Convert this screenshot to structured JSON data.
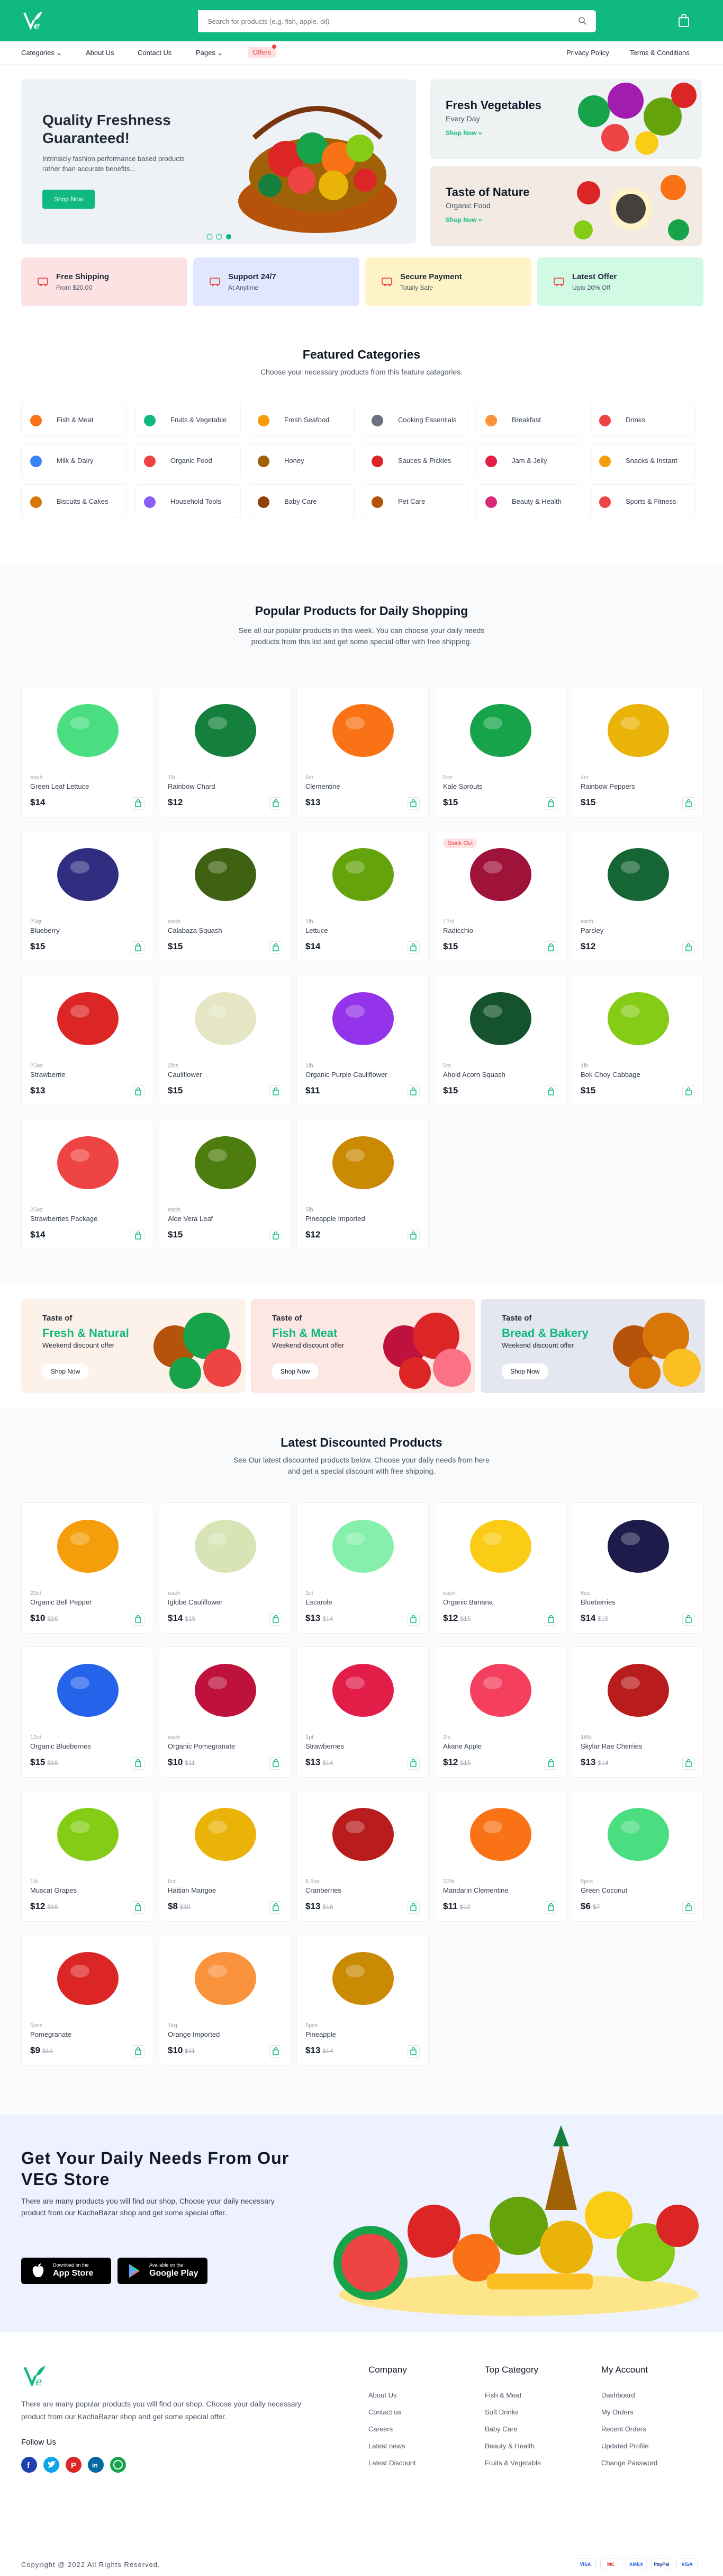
{
  "header": {
    "search_placeholder": "Search for products (e.g. fish, apple, oil)"
  },
  "nav": {
    "categories": "Categories",
    "about": "About Us",
    "contact": "Contact Us",
    "pages": "Pages",
    "offers": "Offers",
    "privacy": "Privacy Policy",
    "terms": "Terms & Conditions"
  },
  "hero": {
    "title": "Quality Freshness Guaranteed!",
    "text": "Intrinsicly fashion performance based products rather than accurate benefits...",
    "button": "Shop Now",
    "slides": 3,
    "active_slide": 3
  },
  "side_banners": [
    {
      "title": "Fresh Vegetables",
      "subtitle": "Every Day",
      "link": "Shop Now »"
    },
    {
      "title": "Taste of Nature",
      "subtitle": "Organic Food",
      "link": "Shop Now »"
    }
  ],
  "features": [
    {
      "title": "Free Shipping",
      "sub": "From $20.00",
      "icon": "truck-icon",
      "bg": "#fde2e4"
    },
    {
      "title": "Support 24/7",
      "sub": "At Anytime",
      "icon": "phone-icon",
      "bg": "#e0e7ff"
    },
    {
      "title": "Secure Payment",
      "sub": "Totally Safe",
      "icon": "card-icon",
      "bg": "#fef3c7"
    },
    {
      "title": "Latest Offer",
      "sub": "Upto 20% Off",
      "icon": "gift-icon",
      "bg": "#d1fae5"
    }
  ],
  "featured": {
    "title": "Featured Categories",
    "sub": "Choose your necessary products from this feature categories."
  },
  "categories": [
    "Fish & Meat",
    "Fruits & Vegetable",
    "Fresh Seafood",
    "Cooking Essentials",
    "Breakfast",
    "Drinks",
    "Milk & Dairy",
    "Organic Food",
    "Honey",
    "Sauces & Pickles",
    "Jam & Jelly",
    "Snacks & Instant",
    "Biscuits & Cakes",
    "Household Tools",
    "Baby Care",
    "Pet Care",
    "Beauty & Health",
    "Sports & Fitness"
  ],
  "category_colors": [
    "#f97316",
    "#10b981",
    "#f59e0b",
    "#6b7280",
    "#fb923c",
    "#ef4444",
    "#3b82f6",
    "#ef4444",
    "#a16207",
    "#dc2626",
    "#e11d48",
    "#f59e0b",
    "#d97706",
    "#8b5cf6",
    "#92400e",
    "#b45309",
    "#db2777",
    "#ef4444"
  ],
  "popular": {
    "title": "Popular Products for Daily Shopping",
    "sub": "See all our popular products in this week. You can choose your daily needs products from this list and get some special offer with free shipping."
  },
  "popular_products": [
    {
      "unit": "each",
      "name": "Green Leaf Lettuce",
      "price": "$14",
      "color": "#4ade80"
    },
    {
      "unit": "1lb",
      "name": "Rainbow Chard",
      "price": "$12",
      "color": "#15803d"
    },
    {
      "unit": "6ct",
      "name": "Clementine",
      "price": "$13",
      "color": "#f97316"
    },
    {
      "unit": "5oz",
      "name": "Kale Sprouts",
      "price": "$15",
      "color": "#16a34a"
    },
    {
      "unit": "4ct",
      "name": "Rainbow Peppers",
      "price": "$15",
      "color": "#eab308"
    },
    {
      "unit": "25qt",
      "name": "Blueberry",
      "price": "$15",
      "color": "#312e81"
    },
    {
      "unit": "each",
      "name": "Calabaza Squash",
      "price": "$15",
      "color": "#3f6212"
    },
    {
      "unit": "1lb",
      "name": "Lettuce",
      "price": "$14",
      "color": "#65a30d"
    },
    {
      "unit": "12ct",
      "name": "Radicchio",
      "price": "$15",
      "color": "#9f1239",
      "badge": "Stock Out"
    },
    {
      "unit": "each",
      "name": "Parsley",
      "price": "$12",
      "color": "#166534"
    },
    {
      "unit": "25oz",
      "name": "Strawberrie",
      "price": "$13",
      "color": "#dc2626"
    },
    {
      "unit": "2lbs",
      "name": "Cauliflower",
      "price": "$15",
      "color": "#e5e7c4"
    },
    {
      "unit": "1lb",
      "name": "Organic Purple Cauliflower",
      "price": "$11",
      "color": "#9333ea"
    },
    {
      "unit": "5ct",
      "name": "Ahold Acorn Squash",
      "price": "$15",
      "color": "#14532d"
    },
    {
      "unit": "1lb",
      "name": "Bok Choy Cabbage",
      "price": "$15",
      "color": "#84cc16"
    },
    {
      "unit": "25oz",
      "name": "Strawberries Package",
      "price": "$14",
      "color": "#ef4444"
    },
    {
      "unit": "each",
      "name": "Aloe Vera Leaf",
      "price": "$15",
      "color": "#4d7c0f"
    },
    {
      "unit": "5lb",
      "name": "Pineapple Imported",
      "price": "$12",
      "color": "#ca8a04"
    }
  ],
  "promos": [
    {
      "taste": "Taste of",
      "head": "Fresh & Natural",
      "sub": "Weekend discount offer",
      "btn": "Shop Now",
      "bg": "#fdf2e9"
    },
    {
      "taste": "Taste of",
      "head": "Fish & Meat",
      "sub": "Weekend discount offer",
      "btn": "Shop Now",
      "bg": "#fce7e2"
    },
    {
      "taste": "Taste of",
      "head": "Bread & Bakery",
      "sub": "Weekend discount offer",
      "btn": "Shop Now",
      "bg": "#e5e7f0"
    }
  ],
  "discount": {
    "title": "Latest Discounted Products",
    "sub": "See Our latest discounted products below. Choose your daily needs from here and get a special discount with free shipping."
  },
  "discount_products": [
    {
      "unit": "22ct",
      "name": "Organic Bell Pepper",
      "price": "$10",
      "old": "$16",
      "color": "#f59e0b"
    },
    {
      "unit": "each",
      "name": "Iglobe Cauliflower",
      "price": "$14",
      "old": "$15",
      "color": "#d9e4b6"
    },
    {
      "unit": "1ct",
      "name": "Escarole",
      "price": "$13",
      "old": "$14",
      "color": "#86efac"
    },
    {
      "unit": "each",
      "name": "Organic Banana",
      "price": "$12",
      "old": "$15",
      "color": "#facc15"
    },
    {
      "unit": "6oz",
      "name": "Blueberries",
      "price": "$14",
      "old": "$15",
      "color": "#1e1b4b"
    },
    {
      "unit": "12ct",
      "name": "Organic Blueberries",
      "price": "$15",
      "old": "$16",
      "color": "#2563eb"
    },
    {
      "unit": "each",
      "name": "Organic Pomegranate",
      "price": "$10",
      "old": "$11",
      "color": "#be123c"
    },
    {
      "unit": "1pt",
      "name": "Strawberries",
      "price": "$13",
      "old": "$14",
      "color": "#e11d48"
    },
    {
      "unit": "2lb",
      "name": "Akane Apple",
      "price": "$12",
      "old": "$15",
      "color": "#f43f5e"
    },
    {
      "unit": "16lb",
      "name": "Skylar Rae Cherries",
      "price": "$13",
      "old": "$14",
      "color": "#b91c1c"
    },
    {
      "unit": "1lb",
      "name": "Muscat Grapes",
      "price": "$12",
      "old": "$16",
      "color": "#84cc16"
    },
    {
      "unit": "6ct",
      "name": "Haitian Mangoe",
      "price": "$8",
      "old": "$10",
      "color": "#eab308"
    },
    {
      "unit": "8.5oz",
      "name": "Cranberries",
      "price": "$13",
      "old": "$16",
      "color": "#b91c1c"
    },
    {
      "unit": "22lb",
      "name": "Mandarin Clementine",
      "price": "$11",
      "old": "$12",
      "color": "#f97316"
    },
    {
      "unit": "5pcs",
      "name": "Green Coconut",
      "price": "$6",
      "old": "$7",
      "color": "#4ade80"
    },
    {
      "unit": "5pcs",
      "name": "Pomegranate",
      "price": "$9",
      "old": "$10",
      "color": "#dc2626"
    },
    {
      "unit": "1kg",
      "name": "Orange Imported",
      "price": "$10",
      "old": "$11",
      "color": "#fb923c"
    },
    {
      "unit": "5pcs",
      "name": "Pineapple",
      "price": "$13",
      "old": "$14",
      "color": "#ca8a04"
    }
  ],
  "app": {
    "title": "Get Your Daily Needs From Our VEG Store",
    "text": "There are many products you will find our shop, Choose your daily necessary product from our KachaBazar shop and get some special offer.",
    "appstore_small": "Download on the",
    "appstore": "App Store",
    "play_small": "Available on the",
    "play": "Google Play"
  },
  "footer": {
    "text": "There are many popular products you will find our shop, Choose your daily necessary product from our KachaBazar shop and get some special offer.",
    "follow": "Follow Us",
    "company_title": "Company",
    "company": [
      "About Us",
      "Contact us",
      "Careers",
      "Latest news",
      "Latest Discount"
    ],
    "top_title": "Top Category",
    "top": [
      "Fish & Meat",
      "Soft Drinks",
      "Baby Care",
      "Beauty & Health",
      "Fruits & Vegetable"
    ],
    "account_title": "My Account",
    "account": [
      "Dashboard",
      "My Orders",
      "Recent Orders",
      "Updated Profile",
      "Change Password"
    ],
    "copyright": "Copyright @ 2022 All Rights Reserved.",
    "payments": [
      "VISA",
      "MC",
      "AMEX",
      "PayPal",
      "VISA"
    ]
  }
}
